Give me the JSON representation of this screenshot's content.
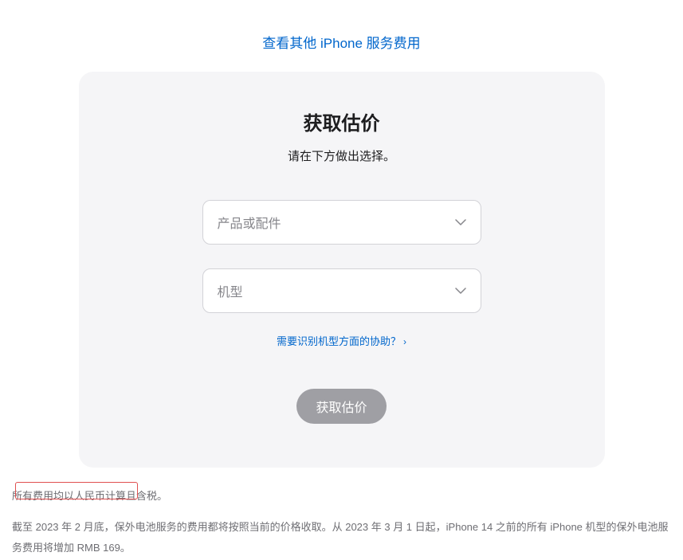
{
  "topLink": {
    "label": "查看其他 iPhone 服务费用"
  },
  "card": {
    "title": "获取估价",
    "subtitle": "请在下方做出选择。",
    "select1": {
      "placeholder": "产品或配件"
    },
    "select2": {
      "placeholder": "机型"
    },
    "helpLink": {
      "label": "需要识别机型方面的协助？"
    },
    "submit": {
      "label": "获取估价"
    }
  },
  "footnote1": "所有费用均以人民币计算且含税。",
  "footnote2": "截至 2023 年 2 月底，保外电池服务的费用都将按照当前的价格收取。从 2023 年 3 月 1 日起，iPhone 14 之前的所有 iPhone 机型的保外电池服务费用将增加 RMB 169。"
}
